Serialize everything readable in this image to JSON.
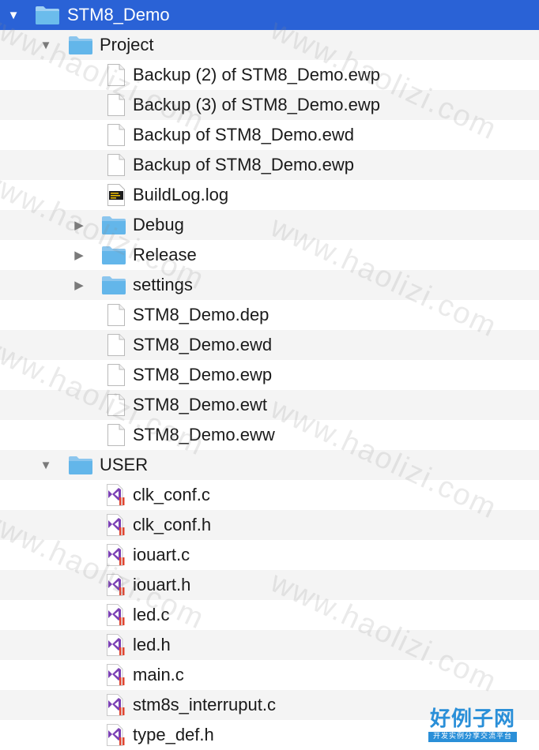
{
  "tree": {
    "root": {
      "label": "STM8_Demo",
      "expanded": true
    },
    "project": {
      "label": "Project",
      "items": [
        {
          "label": "Backup (2) of STM8_Demo.ewp",
          "kind": "document"
        },
        {
          "label": "Backup (3) of STM8_Demo.ewp",
          "kind": "document"
        },
        {
          "label": "Backup of STM8_Demo.ewd",
          "kind": "document"
        },
        {
          "label": "Backup of STM8_Demo.ewp",
          "kind": "document"
        },
        {
          "label": "BuildLog.log",
          "kind": "log"
        },
        {
          "label": "Debug",
          "kind": "folder"
        },
        {
          "label": "Release",
          "kind": "folder"
        },
        {
          "label": "settings",
          "kind": "folder"
        },
        {
          "label": "STM8_Demo.dep",
          "kind": "document"
        },
        {
          "label": "STM8_Demo.ewd",
          "kind": "document"
        },
        {
          "label": "STM8_Demo.ewp",
          "kind": "document"
        },
        {
          "label": "STM8_Demo.ewt",
          "kind": "document"
        },
        {
          "label": "STM8_Demo.eww",
          "kind": "document"
        }
      ]
    },
    "user": {
      "label": "USER",
      "items": [
        {
          "label": "clk_conf.c",
          "kind": "source"
        },
        {
          "label": "clk_conf.h",
          "kind": "source"
        },
        {
          "label": "iouart.c",
          "kind": "source"
        },
        {
          "label": "iouart.h",
          "kind": "source"
        },
        {
          "label": "led.c",
          "kind": "source"
        },
        {
          "label": "led.h",
          "kind": "source"
        },
        {
          "label": "main.c",
          "kind": "source"
        },
        {
          "label": "stm8s_interruput.c",
          "kind": "source"
        },
        {
          "label": "type_def.h",
          "kind": "source"
        }
      ]
    }
  },
  "watermark": {
    "text": "www.haolizi.com",
    "brand": "好例子网",
    "brand_sub": "开发实例分享交流平台"
  },
  "colors": {
    "selection": "#2a62d6",
    "folder": "#63b6ea",
    "stripe": "#f4f4f4",
    "vs_purple": "#7b3fb5",
    "vs_red": "#e0442f"
  }
}
